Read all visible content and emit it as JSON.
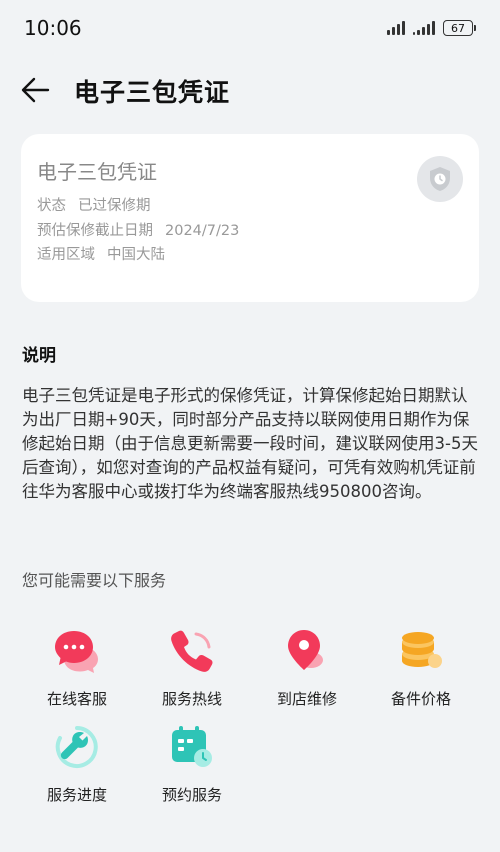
{
  "status_bar": {
    "time": "10:06",
    "battery": "67"
  },
  "header": {
    "title": "电子三包凭证"
  },
  "card": {
    "title": "电子三包凭证",
    "rows": [
      {
        "key": "状态",
        "value": "已过保修期"
      },
      {
        "key": "预估保修截止日期",
        "value": "2024/7/23"
      },
      {
        "key": "适用区域",
        "value": "中国大陆"
      }
    ]
  },
  "explanation": {
    "title": "说明",
    "text": "电子三包凭证是电子形式的保修凭证，计算保修起始日期默认为出厂日期+90天，同时部分产品支持以联网使用日期作为保修起始日期（由于信息更新需要一段时间，建议联网使用3-5天后查询），如您对查询的产品权益有疑问，可凭有效购机凭证前往华为客服中心或拨打华为终端客服热线950800咨询。"
  },
  "services": {
    "title": "您可能需要以下服务",
    "items": [
      {
        "label": "在线客服",
        "icon": "chat-bubble-icon",
        "color": "#f23a5a"
      },
      {
        "label": "服务热线",
        "icon": "phone-icon",
        "color": "#f23a5a"
      },
      {
        "label": "到店维修",
        "icon": "location-pin-icon",
        "color": "#f23a5a"
      },
      {
        "label": "备件价格",
        "icon": "coin-stack-icon",
        "color": "#f5a623"
      },
      {
        "label": "服务进度",
        "icon": "progress-wrench-icon",
        "color": "#2ec4b6"
      },
      {
        "label": "预约服务",
        "icon": "calendar-clock-icon",
        "color": "#2ec4b6"
      }
    ]
  }
}
